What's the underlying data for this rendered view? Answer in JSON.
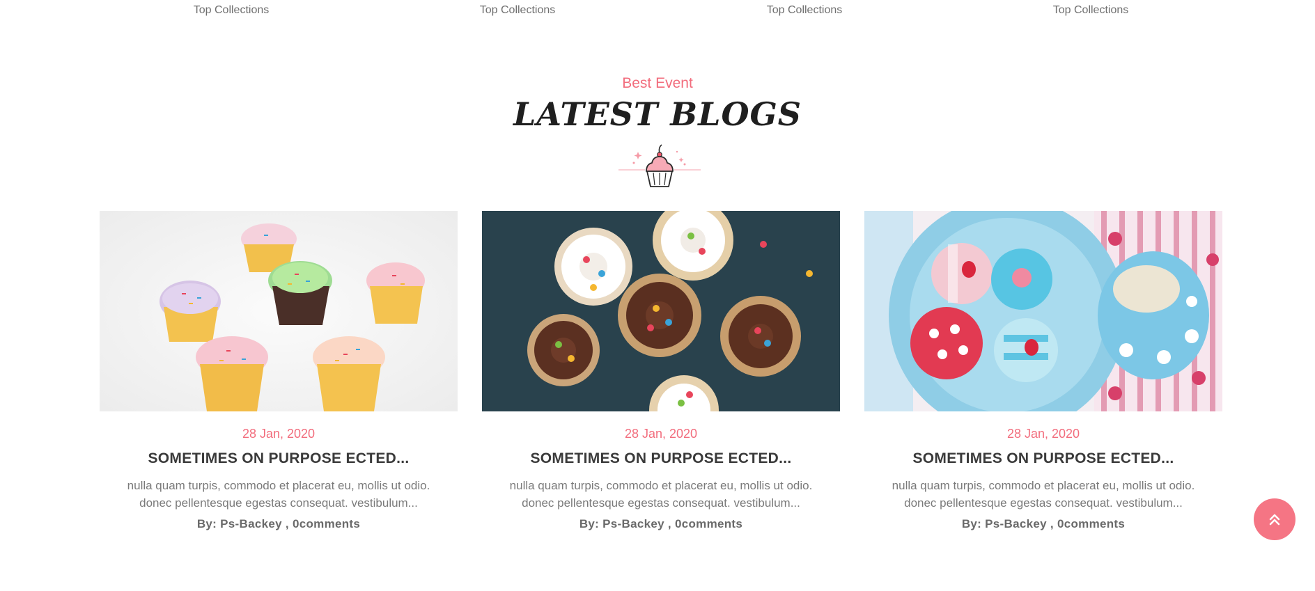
{
  "collections": [
    {
      "label": "Top Collections"
    },
    {
      "label": "Top Collections"
    },
    {
      "label": "Top Collections"
    },
    {
      "label": "Top Collections"
    }
  ],
  "section": {
    "subtitle": "Best Event",
    "title": "LATEST BLOGS",
    "divider_icon": "cupcake-icon"
  },
  "blogs": [
    {
      "date": "28 Jan, 2020",
      "title": "SOMETIMES ON PURPOSE ECTED...",
      "excerpt": "nulla quam turpis, commodo et placerat eu, mollis ut odio. donec pellentesque egestas consequat. vestibulum...",
      "by_label": "By:",
      "author": "Ps-Backey",
      "separator": ",",
      "comments": "0comments",
      "image": "cupcakes-white-background-image"
    },
    {
      "date": "28 Jan, 2020",
      "title": "SOMETIMES ON PURPOSE ECTED...",
      "excerpt": "nulla quam turpis, commodo et placerat eu, mollis ut odio. donec pellentesque egestas consequat. vestibulum...",
      "by_label": "By:",
      "author": "Ps-Backey",
      "separator": ",",
      "comments": "0comments",
      "image": "cupcakes-dark-background-image"
    },
    {
      "date": "28 Jan, 2020",
      "title": "SOMETIMES ON PURPOSE ECTED...",
      "excerpt": "nulla quam turpis, commodo et placerat eu, mollis ut odio. donec pellentesque egestas consequat. vestibulum...",
      "by_label": "By:",
      "author": "Ps-Backey",
      "separator": ",",
      "comments": "0comments",
      "image": "cookies-on-plate-image"
    }
  ],
  "back_to_top": {
    "icon": "double-chevron-up-icon"
  },
  "colors": {
    "accent": "#f26d7d",
    "button": "#f57584",
    "title": "#1f1f1f",
    "text": "#7a7a7a"
  }
}
